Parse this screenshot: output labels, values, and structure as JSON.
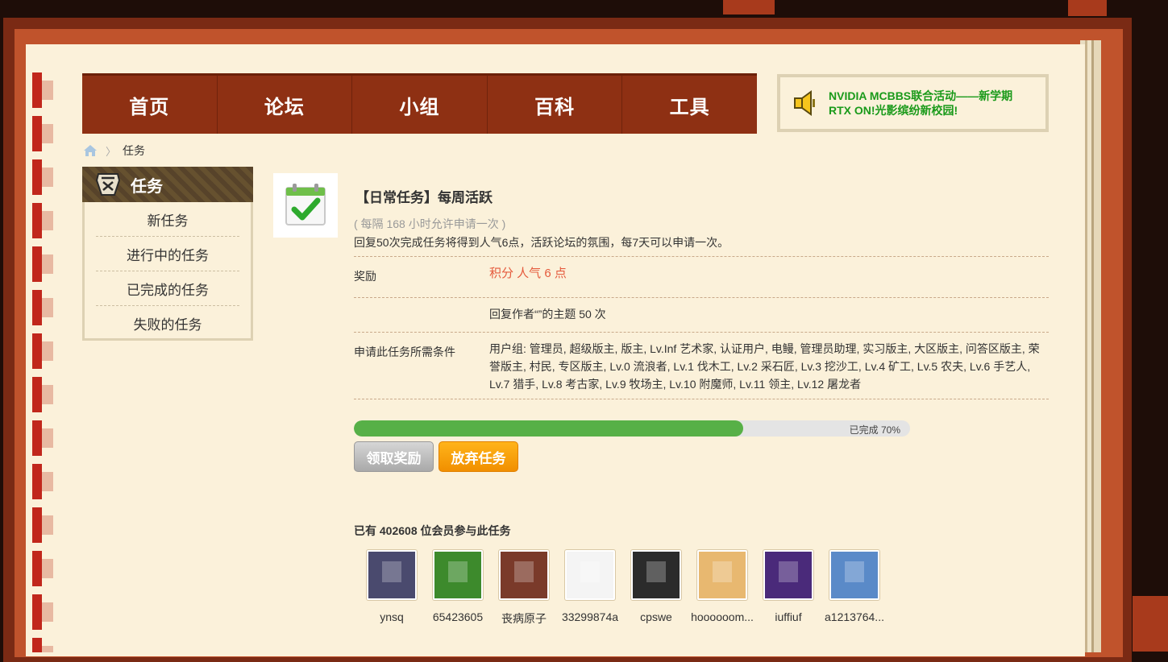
{
  "nav": {
    "items": [
      "首页",
      "论坛",
      "小组",
      "百科",
      "工具"
    ]
  },
  "announcement": {
    "line1": "NVIDIA MCBBS联合活动——新学期",
    "line2": "RTX ON!光影缤纷新校园!"
  },
  "breadcrumb": {
    "current": "任务"
  },
  "sidebar": {
    "title": "任务",
    "items": [
      "新任务",
      "进行中的任务",
      "已完成的任务",
      "失败的任务"
    ]
  },
  "task": {
    "title": "【日常任务】每周活跃",
    "period": "( 每隔 168 小时允许申请一次 )",
    "description": "回复50次完成任务将得到人气6点，活跃论坛的氛围，每7天可以申请一次。",
    "reward_label": "奖励",
    "reward_value": "积分 人气 6 点",
    "requirement_value": "回复作者“”的主题 50 次",
    "conditions_label": "申请此任务所需条件",
    "conditions_value": "用户组: 管理员, 超级版主, 版主, Lv.Inf 艺术家, 认证用户, 电鳗, 管理员助理, 实习版主, 大区版主, 问答区版主, 荣誉版主, 村民, 专区版主, Lv.0 流浪者, Lv.1 伐木工, Lv.2 采石匠, Lv.3 挖沙工, Lv.4 矿工, Lv.5 农夫, Lv.6 手艺人, Lv.7 猎手, Lv.8 考古家, Lv.9 牧场主, Lv.10 附魔师, Lv.11 领主, Lv.12 屠龙者",
    "progress_percent": 70,
    "progress_text": "已完成 70%",
    "claim_button": "领取奖励",
    "abandon_button": "放弃任务"
  },
  "participants": {
    "text": "已有 402608 位会员参与此任务",
    "members": [
      {
        "name": "ynsq",
        "color": "#4a4a6e"
      },
      {
        "name": "65423605",
        "color": "#3d8a2c"
      },
      {
        "name": "丧病原子",
        "color": "#7a3a2a"
      },
      {
        "name": "33299874a",
        "color": "#f4f4f4"
      },
      {
        "name": "cpswe",
        "color": "#2b2b2b"
      },
      {
        "name": "hoooooom...",
        "color": "#e8b870"
      },
      {
        "name": "iuffiuf",
        "color": "#4a2a7a"
      },
      {
        "name": "a1213764...",
        "color": "#5a8ac8"
      }
    ]
  },
  "colors": {
    "nav_bg": "#8e3013",
    "announcement_text": "#1a9a1a",
    "reward_text": "#e55a3c",
    "progress_fill": "#57b047",
    "abandon_button": "#f59a00"
  }
}
